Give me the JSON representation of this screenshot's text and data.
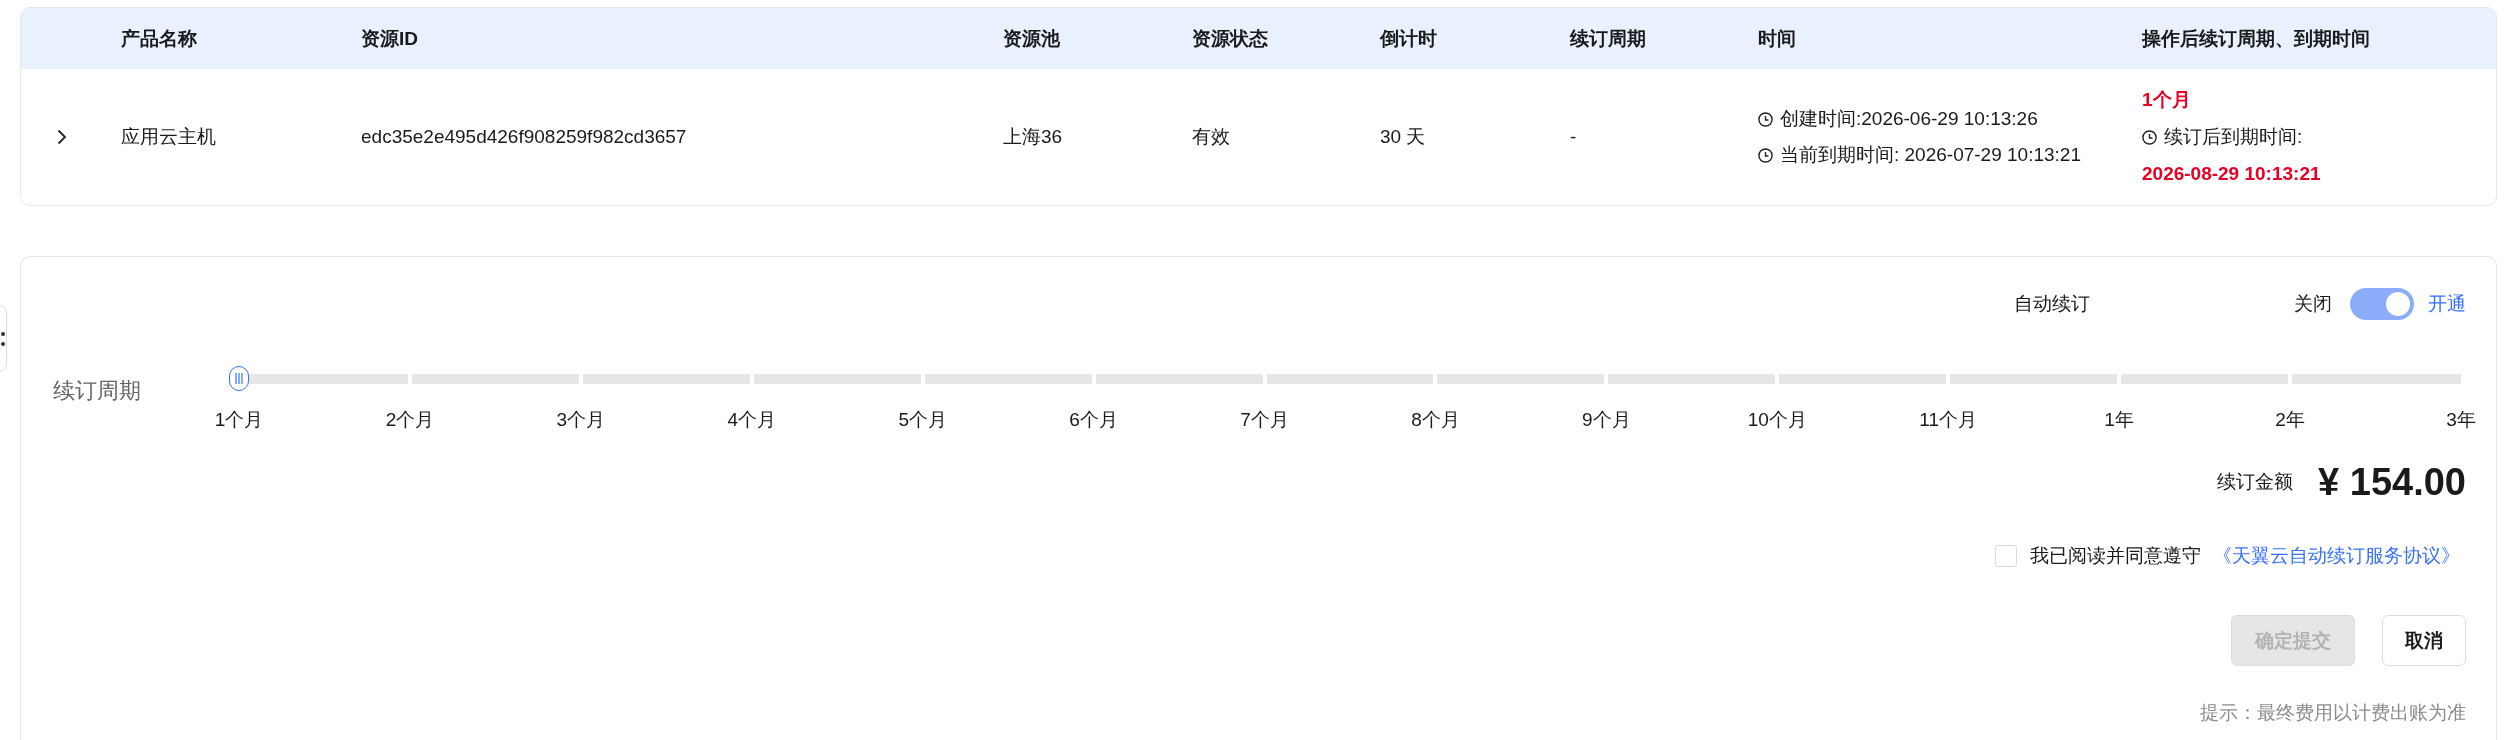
{
  "table": {
    "columns": [
      "产品名称",
      "资源ID",
      "资源池",
      "资源状态",
      "倒计时",
      "续订周期",
      "时间",
      "操作后续订周期、到期时间"
    ],
    "rows": [
      {
        "expanded": false,
        "product_name": "应用云主机",
        "resource_id": "edc35e2e495d426f908259f982cd3657",
        "resource_pool": "上海36",
        "status": "有效",
        "countdown": "30 天",
        "renewal_period": "-",
        "time": [
          "创建时间:2026-06-29 10:13:26",
          "当前到期时间: 2026-07-29 10:13:21"
        ],
        "after_renewal": {
          "period": "1个月",
          "expiry_label": "续订后到期时间:",
          "expiry": "2026-08-29 10:13:21"
        }
      }
    ]
  },
  "renewal_form": {
    "auto_renew": {
      "label": "自动续订",
      "off_label": "关闭",
      "on": true,
      "on_label": "开通"
    },
    "period": {
      "label": "续订周期",
      "level": 0,
      "marks": [
        "1个月",
        "2个月",
        "3个月",
        "4个月",
        "5个月",
        "6个月",
        "7个月",
        "8个月",
        "9个月",
        "10个月",
        "11个月",
        "1年",
        "2年",
        "3年"
      ]
    },
    "amount": {
      "label": "续订金额",
      "value": "¥ 154.00"
    },
    "agreement": {
      "checked": false,
      "text": "我已阅读并同意遵守",
      "link": "《天翼云自动续订服务协议》"
    },
    "buttons": [
      {
        "label": "确定提交",
        "kind": "primary",
        "disabled": true
      },
      {
        "label": "取消",
        "kind": "default",
        "disabled": false
      }
    ],
    "hint": "提示：最终费用以计费出账为准"
  }
}
